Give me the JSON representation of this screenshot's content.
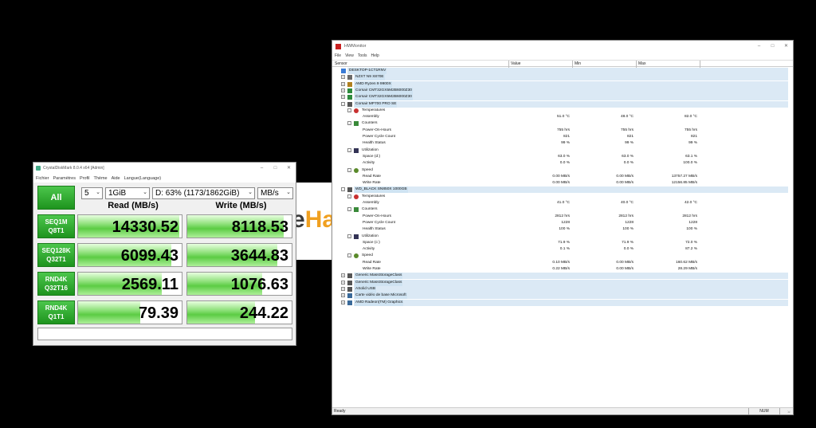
{
  "background_page": {
    "logo_e": "e",
    "logo_h": "Ha"
  },
  "cdm": {
    "title": "CrystalDiskMark 8.0.4 x64 [Admin]",
    "menu": [
      "Fichier",
      "Paramètres",
      "Profil",
      "Thème",
      "Aide",
      "Langue(Language)"
    ],
    "all_label": "All",
    "count": "5",
    "size": "1GiB",
    "drive": "D: 63% (1173/1862GiB)",
    "unit": "MB/s",
    "read_header": "Read (MB/s)",
    "write_header": "Write (MB/s)",
    "rows": [
      {
        "line1": "SEQ1M",
        "line2": "Q8T1",
        "read": "14330.52",
        "write": "8118.53",
        "read_fill": 0.98,
        "write_fill": 0.92
      },
      {
        "line1": "SEQ128K",
        "line2": "Q32T1",
        "read": "6099.43",
        "write": "3644.83",
        "read_fill": 0.9,
        "write_fill": 0.86
      },
      {
        "line1": "RND4K",
        "line2": "Q32T16",
        "read": "2569.11",
        "write": "1076.63",
        "read_fill": 0.81,
        "write_fill": 0.72
      },
      {
        "line1": "RND4K",
        "line2": "Q1T1",
        "read": "79.39",
        "write": "244.22",
        "read_fill": 0.6,
        "write_fill": 0.65
      }
    ]
  },
  "hwm": {
    "title": "HWMonitor",
    "menu": [
      "File",
      "View",
      "Tools",
      "Help"
    ],
    "columns": {
      "sensor": "Sensor",
      "value": "Value",
      "min": "Min",
      "max": "Max"
    },
    "status": "Ready",
    "num": "NUM",
    "rows": [
      {
        "level": 0,
        "label": "DESKTOP-1CT1RNV",
        "icon": "computer-icon",
        "hl": true
      },
      {
        "level": 1,
        "label": "NZXT N9 X870E",
        "icon": "motherboard-icon",
        "hl": true,
        "exp": "+"
      },
      {
        "level": 1,
        "label": "AMD Ryzen 9 9900X",
        "icon": "cpu-icon",
        "hl": true,
        "exp": "+"
      },
      {
        "level": 1,
        "label": "Corsair CMT32GX5M2B6000Z30",
        "icon": "ram-icon",
        "hl": true,
        "exp": "+"
      },
      {
        "level": 1,
        "label": "Corsair CMT32GX5M2B6000Z30",
        "icon": "ram-icon",
        "hl": true,
        "exp": "+"
      },
      {
        "level": 1,
        "label": "Corsair MP700 PRO SE",
        "icon": "drive-icon",
        "hl": true,
        "exp": "-"
      },
      {
        "level": 2,
        "label": "Temperatures",
        "icon": "thermometer-icon",
        "exp": "-"
      },
      {
        "level": 3,
        "label": "Assembly",
        "value": "51.0 °C",
        "min": "48.0 °C",
        "max": "82.0 °C"
      },
      {
        "level": 2,
        "label": "Counters",
        "icon": "counter-icon",
        "exp": "-"
      },
      {
        "level": 3,
        "label": "Power-On-Hours",
        "value": "755 hrs",
        "min": "755 hrs",
        "max": "755 hrs"
      },
      {
        "level": 3,
        "label": "Power Cycle Count",
        "value": "821",
        "min": "821",
        "max": "821"
      },
      {
        "level": 3,
        "label": "Health Status",
        "value": "99 %",
        "min": "99 %",
        "max": "99 %"
      },
      {
        "level": 2,
        "label": "Utilization",
        "icon": "utilization-icon",
        "exp": "-"
      },
      {
        "level": 3,
        "label": "Space (d:)",
        "value": "63.0 %",
        "min": "63.0 %",
        "max": "63.1 %"
      },
      {
        "level": 3,
        "label": "Activity",
        "value": "0.0 %",
        "min": "0.0 %",
        "max": "100.0 %"
      },
      {
        "level": 2,
        "label": "Speed",
        "icon": "speed-icon",
        "exp": "-"
      },
      {
        "level": 3,
        "label": "Read Rate",
        "value": "0.00 MB/s",
        "min": "0.00 MB/s",
        "max": "13757.27 MB/s"
      },
      {
        "level": 3,
        "label": "Write Rate",
        "value": "0.00 MB/s",
        "min": "0.00 MB/s",
        "max": "12156.85 MB/s"
      },
      {
        "level": 1,
        "label": "WD_BLACK SN850X 1000GB",
        "icon": "drive-icon",
        "hl": true,
        "exp": "-"
      },
      {
        "level": 2,
        "label": "Temperatures",
        "icon": "thermometer-icon",
        "exp": "-"
      },
      {
        "level": 3,
        "label": "Assembly",
        "value": "41.0 °C",
        "min": "40.0 °C",
        "max": "42.0 °C"
      },
      {
        "level": 2,
        "label": "Counters",
        "icon": "counter-icon",
        "exp": "-"
      },
      {
        "level": 3,
        "label": "Power-On-Hours",
        "value": "2812 hrs",
        "min": "2812 hrs",
        "max": "2812 hrs"
      },
      {
        "level": 3,
        "label": "Power Cycle Count",
        "value": "1228",
        "min": "1228",
        "max": "1228"
      },
      {
        "level": 3,
        "label": "Health Status",
        "value": "100 %",
        "min": "100 %",
        "max": "100 %"
      },
      {
        "level": 2,
        "label": "Utilization",
        "icon": "utilization-icon",
        "exp": "-"
      },
      {
        "level": 3,
        "label": "Space (c:)",
        "value": "71.9 %",
        "min": "71.9 %",
        "max": "72.0 %"
      },
      {
        "level": 3,
        "label": "Activity",
        "value": "0.1 %",
        "min": "0.0 %",
        "max": "87.2 %"
      },
      {
        "level": 2,
        "label": "Speed",
        "icon": "speed-icon",
        "exp": "-"
      },
      {
        "level": 3,
        "label": "Read Rate",
        "value": "0.10 MB/s",
        "min": "0.00 MB/s",
        "max": "160.62 MB/s"
      },
      {
        "level": 3,
        "label": "Write Rate",
        "value": "0.22 MB/s",
        "min": "0.00 MB/s",
        "max": "28.29 MB/s"
      },
      {
        "level": 1,
        "label": "Generic  MassStorageClass",
        "icon": "drive-icon",
        "hl": true,
        "exp": "+"
      },
      {
        "level": 1,
        "label": "Generic  MassStorageClass",
        "icon": "drive-icon",
        "hl": true,
        "exp": "+"
      },
      {
        "level": 1,
        "label": "ASolid  USB",
        "icon": "drive-icon",
        "hl": true,
        "exp": "+"
      },
      {
        "level": 1,
        "label": "Carte vidéo de base Microsoft",
        "icon": "gpu-icon",
        "hl": true,
        "exp": "+"
      },
      {
        "level": 1,
        "label": "AMD Radeon(TM) Graphics",
        "icon": "gpu-icon",
        "hl": true,
        "exp": "+"
      }
    ]
  }
}
